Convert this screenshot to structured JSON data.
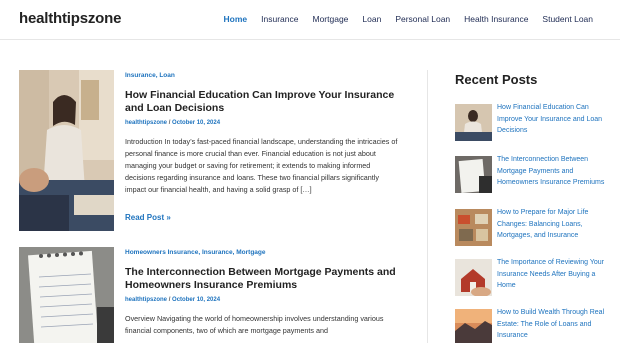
{
  "site": {
    "brand": "healthtipszone"
  },
  "nav": {
    "items": [
      "Home",
      "Insurance",
      "Mortgage",
      "Loan",
      "Personal Loan",
      "Health Insurance",
      "Student Loan"
    ]
  },
  "posts": [
    {
      "categories": "Insurance, Loan",
      "title": "How Financial Education Can Improve Your Insurance and Loan Decisions",
      "author": "healthtipszone",
      "date": "October 10, 2024",
      "excerpt": "Introduction In today’s fast-paced financial landscape, understanding the intricacies of personal finance is more crucial than ever. Financial education is not just about managing your budget or saving for retirement; it extends to making informed decisions regarding insurance and loans. These two financial pillars significantly impact our financial health, and having a solid grasp of […]",
      "read_more": "Read Post »"
    },
    {
      "categories": "Homeowners Insurance, Insurance, Mortgage",
      "title": "The Interconnection Between Mortgage Payments and Homeowners Insurance Premiums",
      "author": "healthtipszone",
      "date": "October 10, 2024",
      "excerpt": "Overview Navigating the world of homeownership involves understanding various financial components, two of which are mortgage payments and"
    }
  ],
  "sidebar": {
    "title": "Recent Posts",
    "recent": [
      "How Financial Education Can Improve Your Insurance and Loan Decisions",
      "The Interconnection Between Mortgage Payments and Homeowners Insurance Premiums",
      "How to Prepare for Major Life Changes: Balancing Loans, Mortgages, and Insurance",
      "The Importance of Reviewing Your Insurance Needs After Buying a Home",
      "How to Build Wealth Through Real Estate: The Role of Loans and Insurance"
    ]
  },
  "colors": {
    "accent": "#1e73be",
    "text": "#222222",
    "nav": "#1f2b53"
  }
}
